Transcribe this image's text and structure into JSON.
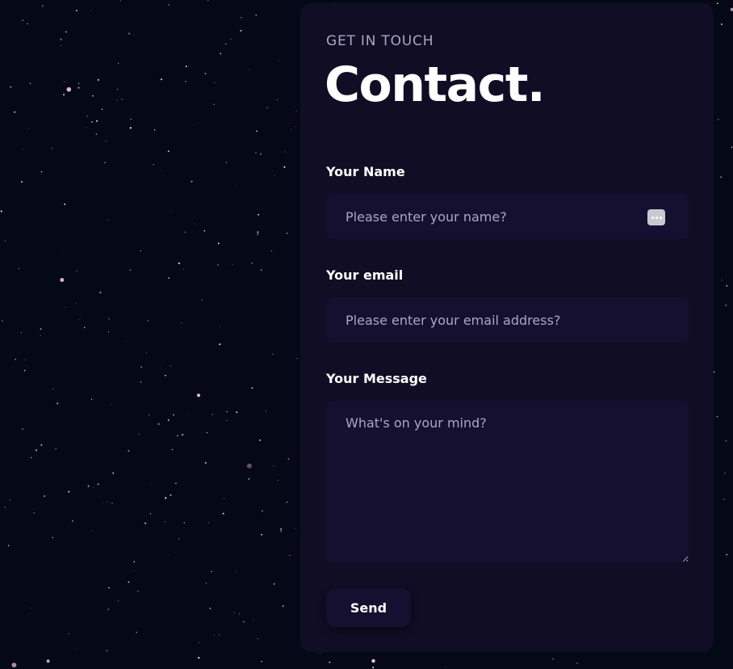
{
  "colors": {
    "background": "#050816",
    "card": "#100d25",
    "field": "#151030",
    "muted_text": "#aaa6c3",
    "heading": "#ffffff"
  },
  "contact": {
    "eyebrow": "Get in touch",
    "title": "Contact.",
    "name_label": "Your Name",
    "name_placeholder": "Please enter your name?",
    "email_label": "Your email",
    "email_placeholder": "Please enter your email address?",
    "message_label": "Your Message",
    "message_placeholder": "What's on your mind?",
    "send_label": "Send",
    "autofill_icon": "more-dots-icon"
  }
}
